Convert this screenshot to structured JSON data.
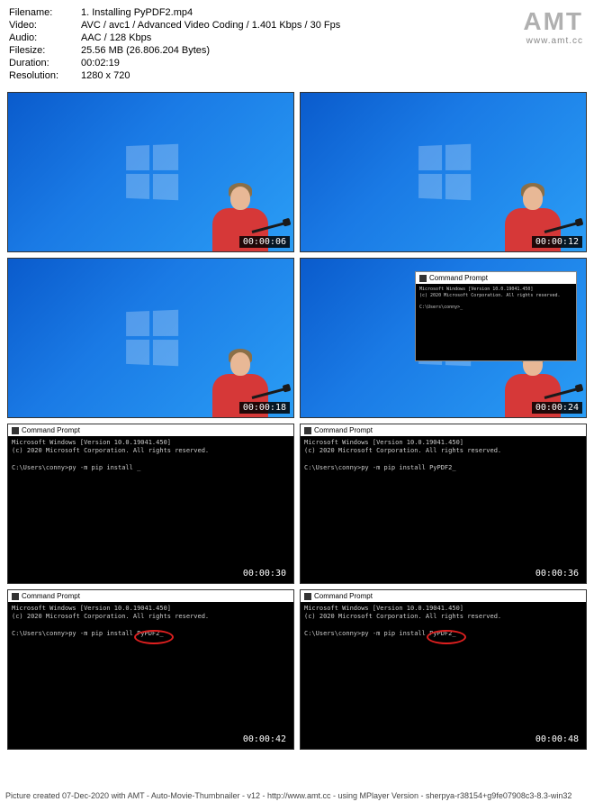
{
  "logo": {
    "text": "AMT",
    "url": "www.amt.cc"
  },
  "meta": {
    "filename_label": "Filename:",
    "filename": "1. Installing PyPDF2.mp4",
    "video_label": "Video:",
    "video": "AVC / avc1 / Advanced Video Coding / 1.401 Kbps / 30 Fps",
    "audio_label": "Audio:",
    "audio": "AAC / 128 Kbps",
    "filesize_label": "Filesize:",
    "filesize": "25.56 MB (26.806.204 Bytes)",
    "duration_label": "Duration:",
    "duration": "00:02:19",
    "resolution_label": "Resolution:",
    "resolution": "1280 x 720"
  },
  "cmd": {
    "title": "Command Prompt",
    "line1": "Microsoft Windows [Version 10.0.19041.450]",
    "line2": "(c) 2020 Microsoft Corporation. All rights reserved.",
    "prompt_blank": "C:\\Users\\conny>_",
    "prompt_partial": "C:\\Users\\conny>py -m pip install _",
    "prompt_full": "C:\\Users\\conny>py -m pip install PyPDF2_"
  },
  "thumbs": [
    {
      "ts": "00:00:06"
    },
    {
      "ts": "00:00:12"
    },
    {
      "ts": "00:00:18"
    },
    {
      "ts": "00:00:24"
    },
    {
      "ts": "00:00:30"
    },
    {
      "ts": "00:00:36"
    },
    {
      "ts": "00:00:42"
    },
    {
      "ts": "00:00:48"
    }
  ],
  "footer": "Picture created 07-Dec-2020 with AMT - Auto-Movie-Thumbnailer - v12 - http://www.amt.cc - using MPlayer Version - sherpya-r38154+g9fe07908c3-8.3-win32"
}
